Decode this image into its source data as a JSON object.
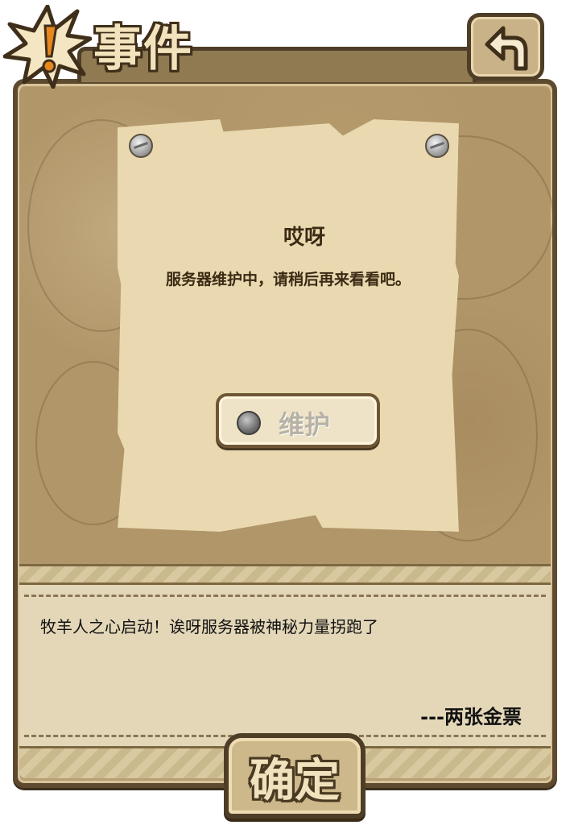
{
  "header": {
    "title": "事件"
  },
  "notice": {
    "title": "哎呀",
    "message": "服务器维护中，请稍后再来看看吧。",
    "status_button_label": "维护"
  },
  "event": {
    "description": "牧羊人之心启动！诶呀服务器被神秘力量拐跑了",
    "reward": "---两张金票"
  },
  "footer": {
    "confirm_label": "确定"
  },
  "icons": {
    "badge": "exclamation-burst-icon",
    "back": "back-arrow-icon",
    "status": "gray-dot-icon"
  }
}
